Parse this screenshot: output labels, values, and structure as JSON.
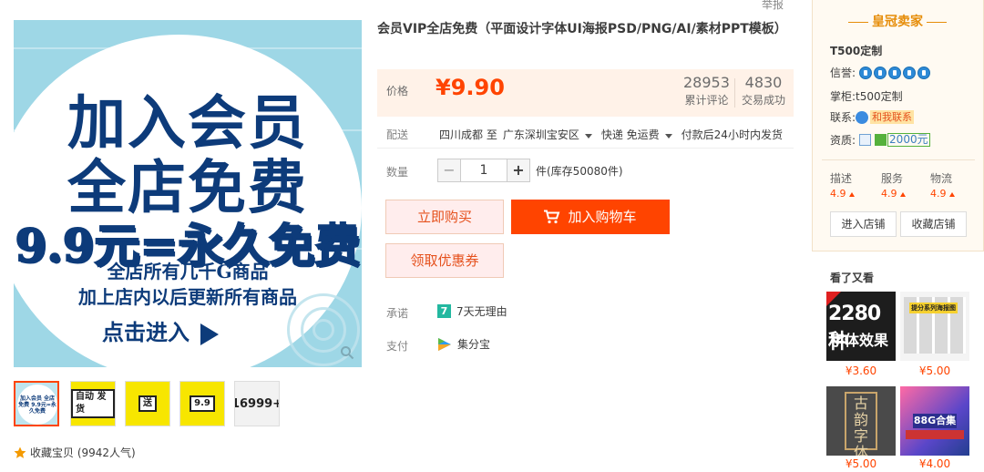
{
  "header": {
    "report": "举报"
  },
  "product": {
    "title": "会员VIP全店免费（平面设计字体UI海报PSD/PNG/AI/素材PPT模板）",
    "price_label": "价格",
    "price": "¥9.90",
    "reviews_count": "28953",
    "reviews_label": "累计评论",
    "deals_count": "4830",
    "deals_label": "交易成功",
    "shipping_label": "配送",
    "ship_from": "四川成都 至",
    "ship_to": "广东深圳宝安区",
    "ship_method": "快递 免运费",
    "ship_time": "付款后24小时内发货",
    "quantity_label": "数量",
    "quantity": "1",
    "qty_minus": "−",
    "qty_plus": "+",
    "stock": "件(库存50080件)",
    "buy_now": "立即购买",
    "add_cart": "加入购物车",
    "coupon": "领取优惠券",
    "promise_label": "承诺",
    "promise_badge": "7",
    "promise_text": "7天无理由",
    "pay_label": "支付",
    "pay_text": "集分宝"
  },
  "gallery": {
    "main": {
      "line1": "加入会员",
      "line2": "全店免费",
      "line3": "9.9元=永久免费",
      "line4": "全店所有几千G商品",
      "line5": "加上店内以后更新所有商品",
      "line6": "点击进入"
    },
    "thumbs": [
      {
        "text": "加入会员 全店免费 9.9元=永久免费"
      },
      {
        "text": "自动 发货"
      },
      {
        "text": "送"
      },
      {
        "text": "9.9"
      },
      {
        "text": "16999+"
      }
    ],
    "favorite": "收藏宝贝 (9942人气)"
  },
  "seller": {
    "badge": "皇冠卖家",
    "shop_name": "T500定制",
    "credit_label": "信誉:",
    "keeper_label": "掌柜:",
    "keeper": "t500定制",
    "contact_label": "联系:",
    "contact": "和我联系",
    "qual_label": "资质:",
    "qual_amount": "2000元",
    "scores": [
      {
        "label": "描述",
        "value": "4.9"
      },
      {
        "label": "服务",
        "value": "4.9"
      },
      {
        "label": "物流",
        "value": "4.9"
      }
    ],
    "enter_shop": "进入店铺",
    "fav_shop": "收藏店铺"
  },
  "recommend": {
    "title": "看了又看",
    "items": [
      {
        "price": "¥3.60",
        "big": "2280种",
        "sub": "字体效果"
      },
      {
        "price": "¥5.00",
        "tag": "提分系列海报图"
      },
      {
        "price": "¥5.00",
        "char": "古韵字体"
      },
      {
        "price": "¥4.00",
        "bar": "88G合集"
      }
    ]
  },
  "colors": {
    "accent": "#ff4400",
    "price": "#ff4400",
    "seller_bg": "#fffaf2",
    "brand_blue": "#0d3b7a"
  }
}
